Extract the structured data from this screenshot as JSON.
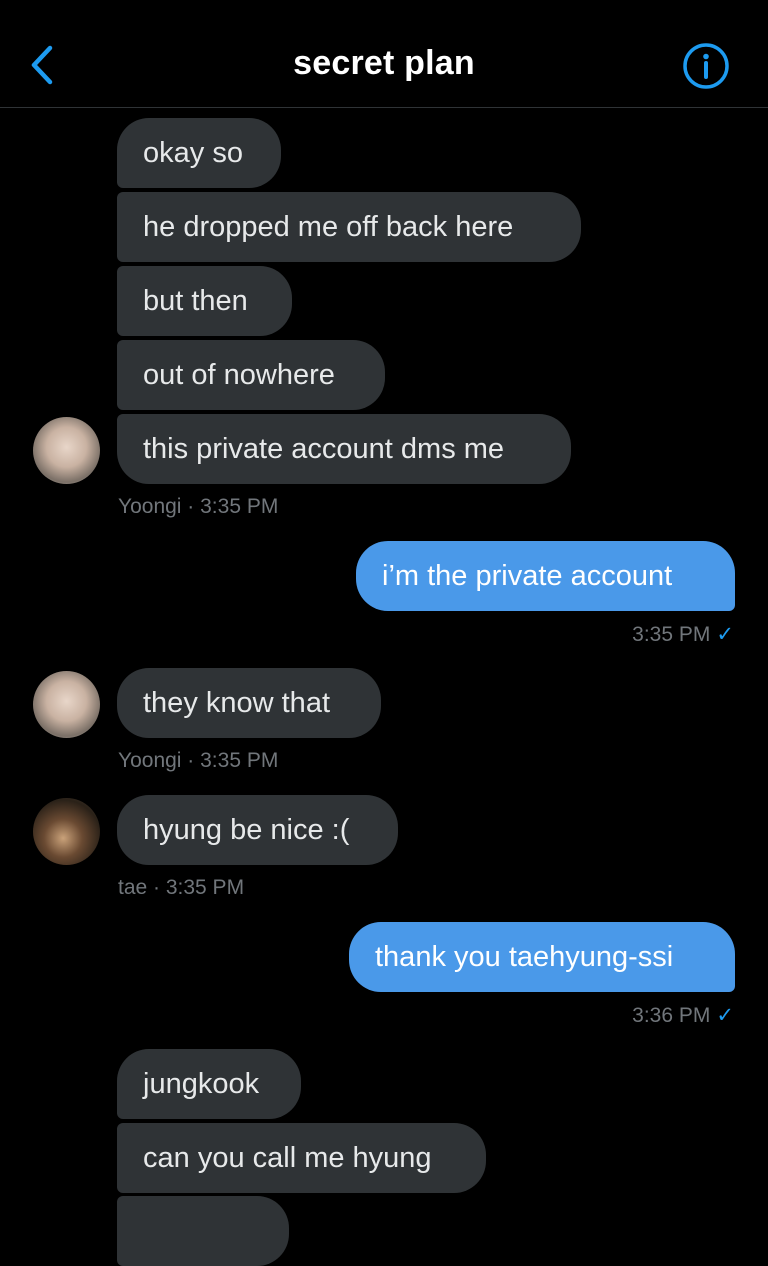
{
  "header": {
    "title": "secret plan",
    "back_icon": "chevron-left-icon",
    "info_icon": "info-circle-icon",
    "accent": "#1d9bf0"
  },
  "colors": {
    "received_bubble": "#2f3336",
    "sent_bubble": "#4a99e9",
    "meta_text": "#71767b"
  },
  "messages": [
    {
      "text": "okay so",
      "side": "received"
    },
    {
      "text": "he dropped me off back here",
      "side": "received"
    },
    {
      "text": "but then",
      "side": "received"
    },
    {
      "text": "out of nowhere",
      "side": "received"
    },
    {
      "text": "this private account dms me",
      "side": "received",
      "meta": "Yoongi · 3:35 PM"
    },
    {
      "text": "i’m the private account",
      "side": "sent",
      "meta": "3:35 PM"
    },
    {
      "text": "they know that",
      "side": "received",
      "meta": "Yoongi · 3:35 PM"
    },
    {
      "text": "hyung be nice :(",
      "side": "received",
      "meta": "tae · 3:35 PM"
    },
    {
      "text": "thank you taehyung-ssi",
      "side": "sent",
      "meta": "3:36 PM"
    },
    {
      "text": "jungkook",
      "side": "received"
    },
    {
      "text": "can you call me hyung",
      "side": "received"
    }
  ],
  "check_glyph": "✓"
}
